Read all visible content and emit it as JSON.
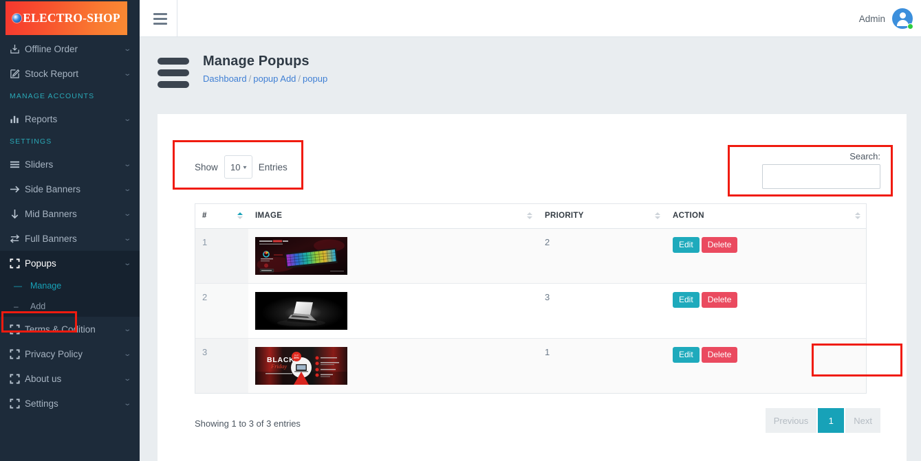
{
  "brand": {
    "logo_text": "ELECTRO-SHOP",
    "logo_icon": "globe-icon"
  },
  "topnav": {
    "menu_icon": "hamburger-icon",
    "user_name": "Admin",
    "avatar_icon": "user-avatar-icon",
    "status": "online"
  },
  "sidebar": {
    "items": [
      {
        "label": "Offline Order",
        "icon": "download-box-icon",
        "caret": "⌄",
        "type": "link"
      },
      {
        "label": "Stock Report",
        "icon": "edit-square-icon",
        "caret": "⌄",
        "type": "link"
      },
      {
        "label": "MANAGE ACCOUNTS",
        "type": "section"
      },
      {
        "label": "Reports",
        "icon": "bar-chart-icon",
        "caret": "⌄",
        "type": "link"
      },
      {
        "label": "SETTINGS",
        "type": "section"
      },
      {
        "label": "Sliders",
        "icon": "menu-lines-icon",
        "caret": "⌄",
        "type": "link"
      },
      {
        "label": "Side Banners",
        "icon": "arrow-right-icon",
        "caret": "⌄",
        "type": "link"
      },
      {
        "label": "Mid Banners",
        "icon": "arrow-down-icon",
        "caret": "⌄",
        "type": "link"
      },
      {
        "label": "Full Banners",
        "icon": "arrows-exchange-icon",
        "caret": "⌄",
        "type": "link"
      },
      {
        "label": "Popups",
        "icon": "expand-corners-icon",
        "caret": "⌄",
        "type": "link",
        "active": true
      },
      {
        "label": "Terms & Codition",
        "icon": "expand-corners-icon",
        "caret": "⌄",
        "type": "link"
      },
      {
        "label": "Privacy Policy",
        "icon": "expand-corners-icon",
        "caret": "⌄",
        "type": "link"
      },
      {
        "label": "About us",
        "icon": "expand-corners-icon",
        "caret": "⌄",
        "type": "link"
      },
      {
        "label": "Settings",
        "icon": "expand-corners-icon",
        "caret": "⌄",
        "type": "link"
      }
    ],
    "submenu": [
      {
        "label": "Manage",
        "marker": "—",
        "selected": true
      },
      {
        "label": "Add",
        "marker": "–",
        "selected": false
      }
    ]
  },
  "page": {
    "title": "Manage Popups",
    "breadcrumb": [
      {
        "label": "Dashboard",
        "link": true
      },
      {
        "label": "popup Add",
        "link": true
      },
      {
        "label": "popup",
        "link": true
      }
    ],
    "breadcrumb_separator": "/"
  },
  "controls": {
    "show_label": "Show",
    "entries_value": "10",
    "entries_caret": "▾",
    "entries_label": "Entries",
    "search_label": "Search:",
    "search_value": "",
    "search_placeholder": ""
  },
  "table": {
    "columns": [
      {
        "label": "#",
        "sorted": true
      },
      {
        "label": "IMAGE",
        "sorted": false
      },
      {
        "label": "PRIORITY",
        "sorted": false
      },
      {
        "label": "ACTION",
        "sorted": false
      }
    ],
    "rows": [
      {
        "index": "1",
        "priority": "2",
        "image_alt": "rgb-gaming-keyboard-banner",
        "edit": "Edit",
        "delete": "Delete"
      },
      {
        "index": "2",
        "priority": "3",
        "image_alt": "laptop-dark-banner",
        "edit": "Edit",
        "delete": "Delete"
      },
      {
        "index": "3",
        "priority": "1",
        "image_alt": "black-friday-promo-banner",
        "edit": "Edit",
        "delete": "Delete"
      }
    ]
  },
  "footer": {
    "info": "Showing 1 to 3 of 3 entries",
    "pagination": {
      "previous": "Previous",
      "current": "1",
      "next": "Next"
    }
  },
  "colors": {
    "sidebar_bg": "#1d2b3a",
    "accent_teal": "#17a2b8",
    "delete_red": "#ea4a5f",
    "highlight_red": "#f01b0f",
    "link_blue": "#3f7fd4",
    "logo_gradient_start": "#f6372f",
    "logo_gradient_end": "#fa8a33"
  }
}
